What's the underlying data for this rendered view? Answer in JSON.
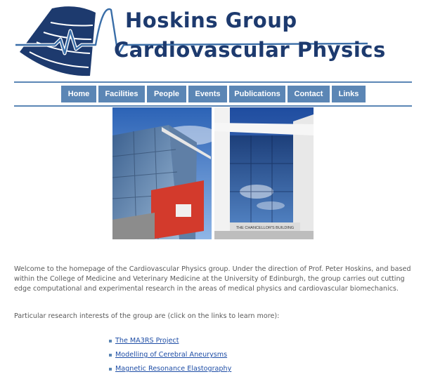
{
  "logo": {
    "title": "Hoskins Group",
    "subtitle": "Cardiovascular Physics",
    "icon": "ultrasound-heart-icon",
    "colors": {
      "brand_dark": "#1d3a6e",
      "brand_light": "#5b86b5"
    }
  },
  "nav": {
    "items": [
      {
        "label": "Home"
      },
      {
        "label": "Facilities"
      },
      {
        "label": "People"
      },
      {
        "label": "Events"
      },
      {
        "label": "Publications"
      },
      {
        "label": "Contact"
      },
      {
        "label": "Links"
      }
    ],
    "color": "#5b86b5"
  },
  "photos": {
    "right_sign": "THE CHANCELLOR'S BUILDING"
  },
  "intro": "Welcome to the homepage of the Cardiovascular Physics group. Under the direction of Prof. Peter Hoskins, and based within the College of Medicine and Veterinary Medicine at the University of Edinburgh, the group carries out cutting edge computational and experimental research in the areas of medical physics and cardiovascular biomechanics.",
  "interests_heading": "Particular research interests of the group are (click on the links to learn more):",
  "research_links": [
    {
      "label": "The MA3RS Project"
    },
    {
      "label": "Modelling of Cerebral Aneurysms"
    },
    {
      "label": "Magnetic Resonance Elastography"
    }
  ]
}
